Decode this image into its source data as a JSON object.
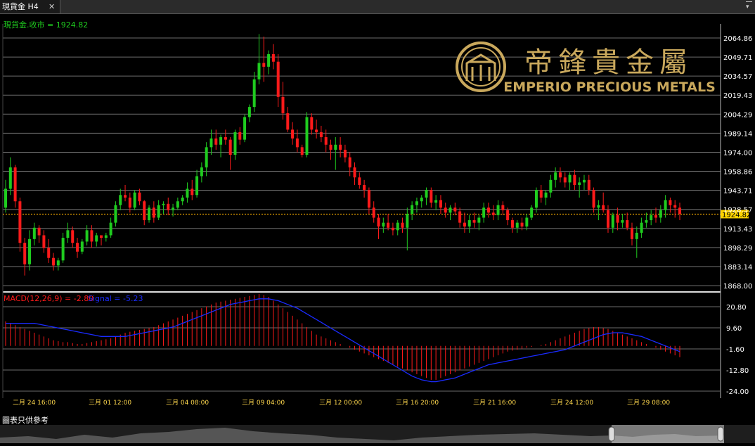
{
  "window": {
    "tab_title": "現貨金 H4",
    "close_glyph": "✕",
    "menu_glyph": "▾"
  },
  "price_panel": {
    "label": "現貨金.收市 = 1924.82",
    "current_price": 1924.82,
    "current_price_label": "1924.82",
    "y_axis_ticks": [
      "2064.86",
      "2049.71",
      "2034.57",
      "2019.43",
      "2004.29",
      "1989.14",
      "1974.00",
      "1958.86",
      "1943.71",
      "1928.57",
      "1913.43",
      "1898.29",
      "1883.14",
      "1868.00"
    ],
    "y_axis_values": [
      2064.86,
      2049.71,
      2034.57,
      2019.43,
      2004.29,
      1989.14,
      1974.0,
      1958.86,
      1943.71,
      1928.57,
      1913.43,
      1898.29,
      1883.14,
      1868.0
    ]
  },
  "watermark": {
    "name_chinese": "帝鋒貴金屬",
    "name_english": "EMPERIO PRECIOUS METALS"
  },
  "macd_panel": {
    "macd_label": "MACD(12,26,9) = -2.80",
    "signal_label": "Signal = -5.23",
    "y_axis_ticks": [
      "20.80",
      "9.60",
      "-1.60",
      "-12.80",
      "-24.00"
    ],
    "y_axis_values": [
      20.8,
      9.6,
      -1.6,
      -12.8,
      -24.0
    ]
  },
  "time_axis": {
    "labels": [
      "二月 24 16:00",
      "三月 01 12:00",
      "三月 04 08:00",
      "三月 09 04:00",
      "三月 12 00:00",
      "三月 16 20:00",
      "三月 21 16:00",
      "三月 24 12:00",
      "三月 29 08:00"
    ]
  },
  "footer": {
    "disclaimer": "圖表只供參考"
  },
  "colors": {
    "up": "#1fcc1f",
    "down": "#ff1a1a",
    "signal_line": "#1a2bff",
    "grid": "#6b6b6b",
    "axis_text": "#ffffff",
    "price_line": "#ffb300",
    "gold": "#c9a85c"
  },
  "chart_data": {
    "type": "candlestick",
    "timeframe": "H4",
    "symbol": "現貨金",
    "ohlc": [
      [
        1930,
        1952,
        1926,
        1945
      ],
      [
        1945,
        1970,
        1940,
        1962
      ],
      [
        1962,
        1964,
        1930,
        1935
      ],
      [
        1935,
        1938,
        1895,
        1902
      ],
      [
        1902,
        1906,
        1876,
        1885
      ],
      [
        1885,
        1912,
        1880,
        1905
      ],
      [
        1905,
        1918,
        1900,
        1914
      ],
      [
        1914,
        1916,
        1902,
        1908
      ],
      [
        1908,
        1912,
        1894,
        1898
      ],
      [
        1898,
        1905,
        1886,
        1890
      ],
      [
        1890,
        1894,
        1880,
        1884
      ],
      [
        1884,
        1890,
        1880,
        1888
      ],
      [
        1888,
        1910,
        1886,
        1906
      ],
      [
        1906,
        1918,
        1902,
        1912
      ],
      [
        1912,
        1915,
        1898,
        1902
      ],
      [
        1902,
        1906,
        1890,
        1895
      ],
      [
        1895,
        1905,
        1893,
        1903
      ],
      [
        1903,
        1916,
        1900,
        1912
      ],
      [
        1912,
        1916,
        1898,
        1903
      ],
      [
        1903,
        1910,
        1899,
        1908
      ],
      [
        1908,
        1908,
        1900,
        1906
      ],
      [
        1906,
        1910,
        1903,
        1908
      ],
      [
        1908,
        1922,
        1906,
        1918
      ],
      [
        1918,
        1935,
        1915,
        1932
      ],
      [
        1932,
        1945,
        1928,
        1940
      ],
      [
        1940,
        1948,
        1935,
        1938
      ],
      [
        1938,
        1942,
        1926,
        1930
      ],
      [
        1930,
        1944,
        1928,
        1942
      ],
      [
        1942,
        1945,
        1932,
        1935
      ],
      [
        1935,
        1936,
        1916,
        1920
      ],
      [
        1920,
        1932,
        1918,
        1930
      ],
      [
        1930,
        1935,
        1918,
        1922
      ],
      [
        1922,
        1936,
        1920,
        1932
      ],
      [
        1932,
        1935,
        1925,
        1933
      ],
      [
        1933,
        1938,
        1924,
        1928
      ],
      [
        1928,
        1933,
        1923,
        1930
      ],
      [
        1930,
        1938,
        1928,
        1935
      ],
      [
        1935,
        1940,
        1932,
        1938
      ],
      [
        1938,
        1950,
        1934,
        1945
      ],
      [
        1945,
        1952,
        1936,
        1940
      ],
      [
        1940,
        1960,
        1938,
        1955
      ],
      [
        1955,
        1966,
        1950,
        1962
      ],
      [
        1962,
        1982,
        1955,
        1978
      ],
      [
        1978,
        1992,
        1972,
        1985
      ],
      [
        1985,
        1992,
        1976,
        1980
      ],
      [
        1980,
        1988,
        1970,
        1986
      ],
      [
        1986,
        1992,
        1980,
        1984
      ],
      [
        1984,
        1986,
        1960,
        1972
      ],
      [
        1972,
        1992,
        1968,
        1990
      ],
      [
        1990,
        1994,
        1980,
        1984
      ],
      [
        1984,
        2004,
        1982,
        2002
      ],
      [
        2002,
        2012,
        1998,
        2010
      ],
      [
        2010,
        2038,
        2006,
        2032
      ],
      [
        2032,
        2068,
        2028,
        2045
      ],
      [
        2045,
        2066,
        2030,
        2042
      ],
      [
        2042,
        2055,
        2036,
        2052
      ],
      [
        2052,
        2060,
        2040,
        2046
      ],
      [
        2046,
        2052,
        2010,
        2018
      ],
      [
        2018,
        2030,
        2000,
        2005
      ],
      [
        2005,
        2010,
        1990,
        1992
      ],
      [
        1992,
        1998,
        1980,
        1985
      ],
      [
        1985,
        1992,
        1974,
        1978
      ],
      [
        1978,
        1980,
        1970,
        1972
      ],
      [
        1972,
        2006,
        1970,
        2002
      ],
      [
        2002,
        2005,
        1988,
        1992
      ],
      [
        1992,
        2000,
        1985,
        1990
      ],
      [
        1990,
        1995,
        1982,
        1986
      ],
      [
        1986,
        1992,
        1974,
        1980
      ],
      [
        1980,
        1984,
        1968,
        1976
      ],
      [
        1976,
        1986,
        1960,
        1980
      ],
      [
        1980,
        1986,
        1970,
        1976
      ],
      [
        1976,
        1980,
        1966,
        1970
      ],
      [
        1970,
        1974,
        1955,
        1962
      ],
      [
        1962,
        1966,
        1948,
        1954
      ],
      [
        1954,
        1958,
        1945,
        1948
      ],
      [
        1948,
        1952,
        1938,
        1944
      ],
      [
        1944,
        1946,
        1925,
        1930
      ],
      [
        1930,
        1935,
        1918,
        1922
      ],
      [
        1922,
        1925,
        1905,
        1915
      ],
      [
        1915,
        1922,
        1910,
        1918
      ],
      [
        1918,
        1925,
        1912,
        1914
      ],
      [
        1914,
        1918,
        1908,
        1912
      ],
      [
        1912,
        1920,
        1908,
        1918
      ],
      [
        1918,
        1922,
        1910,
        1914
      ],
      [
        1914,
        1930,
        1896,
        1925
      ],
      [
        1925,
        1935,
        1920,
        1932
      ],
      [
        1932,
        1938,
        1926,
        1935
      ],
      [
        1935,
        1940,
        1930,
        1938
      ],
      [
        1938,
        1946,
        1932,
        1944
      ],
      [
        1944,
        1946,
        1930,
        1934
      ],
      [
        1934,
        1940,
        1928,
        1936
      ],
      [
        1936,
        1940,
        1925,
        1930
      ],
      [
        1930,
        1934,
        1922,
        1926
      ],
      [
        1926,
        1932,
        1920,
        1930
      ],
      [
        1930,
        1934,
        1924,
        1927
      ],
      [
        1927,
        1930,
        1914,
        1918
      ],
      [
        1918,
        1926,
        1910,
        1915
      ],
      [
        1915,
        1924,
        1910,
        1920
      ],
      [
        1920,
        1926,
        1914,
        1918
      ],
      [
        1918,
        1924,
        1912,
        1922
      ],
      [
        1922,
        1934,
        1918,
        1930
      ],
      [
        1930,
        1934,
        1922,
        1926
      ],
      [
        1926,
        1932,
        1920,
        1924
      ],
      [
        1924,
        1936,
        1920,
        1932
      ],
      [
        1932,
        1935,
        1924,
        1928
      ],
      [
        1928,
        1930,
        1916,
        1920
      ],
      [
        1920,
        1922,
        1910,
        1914
      ],
      [
        1914,
        1920,
        1910,
        1918
      ],
      [
        1918,
        1922,
        1912,
        1915
      ],
      [
        1915,
        1925,
        1912,
        1922
      ],
      [
        1922,
        1932,
        1920,
        1930
      ],
      [
        1930,
        1946,
        1926,
        1944
      ],
      [
        1944,
        1948,
        1934,
        1938
      ],
      [
        1938,
        1944,
        1932,
        1942
      ],
      [
        1942,
        1956,
        1938,
        1952
      ],
      [
        1952,
        1962,
        1946,
        1958
      ],
      [
        1958,
        1962,
        1950,
        1954
      ],
      [
        1954,
        1958,
        1946,
        1950
      ],
      [
        1950,
        1958,
        1944,
        1956
      ],
      [
        1956,
        1960,
        1944,
        1948
      ],
      [
        1948,
        1954,
        1938,
        1950
      ],
      [
        1950,
        1956,
        1944,
        1952
      ],
      [
        1952,
        1956,
        1940,
        1944
      ],
      [
        1944,
        1946,
        1926,
        1930
      ],
      [
        1930,
        1936,
        1920,
        1932
      ],
      [
        1932,
        1942,
        1926,
        1928
      ],
      [
        1928,
        1932,
        1910,
        1914
      ],
      [
        1914,
        1926,
        1910,
        1924
      ],
      [
        1924,
        1930,
        1912,
        1918
      ],
      [
        1918,
        1925,
        1914,
        1920
      ],
      [
        1920,
        1926,
        1912,
        1914
      ],
      [
        1914,
        1918,
        1900,
        1905
      ],
      [
        1905,
        1915,
        1890,
        1910
      ],
      [
        1910,
        1922,
        1906,
        1918
      ],
      [
        1918,
        1926,
        1914,
        1920
      ],
      [
        1920,
        1928,
        1916,
        1924
      ],
      [
        1924,
        1930,
        1918,
        1922
      ],
      [
        1922,
        1932,
        1918,
        1928
      ],
      [
        1928,
        1940,
        1922,
        1936
      ],
      [
        1936,
        1938,
        1926,
        1932
      ],
      [
        1932,
        1936,
        1922,
        1930
      ],
      [
        1930,
        1934,
        1920,
        1925
      ]
    ],
    "macd_histogram": [
      13,
      12,
      11,
      10,
      9,
      8,
      7,
      6,
      5,
      4,
      3,
      2.5,
      2,
      2,
      1.5,
      1,
      1,
      1.5,
      2,
      2.5,
      3,
      3.5,
      4,
      5,
      6,
      7,
      7.5,
      8,
      8.5,
      9,
      9.5,
      10,
      11,
      12,
      13,
      14,
      15,
      16,
      17,
      18,
      19,
      20,
      21,
      22,
      23,
      23.5,
      24,
      24.5,
      25,
      25.5,
      26,
      26.5,
      27,
      27.5,
      27,
      26,
      24,
      22,
      20,
      18,
      16,
      14,
      12,
      10,
      8,
      6,
      5,
      4,
      3,
      2,
      1,
      0,
      -1,
      -2,
      -3,
      -4,
      -5,
      -6,
      -7,
      -8,
      -9,
      -10,
      -11,
      -12,
      -13,
      -14,
      -15,
      -16,
      -17,
      -18,
      -18,
      -17,
      -16,
      -15,
      -14,
      -13,
      -12,
      -11,
      -10,
      -9,
      -8,
      -7,
      -6,
      -5,
      -4,
      -3,
      -2.5,
      -2,
      -1.5,
      -1,
      -0.5,
      0,
      0.5,
      1,
      2,
      3,
      4,
      5,
      6,
      7,
      8,
      9,
      9.5,
      10,
      10,
      9.5,
      9,
      8,
      7,
      6,
      5,
      4,
      3,
      2,
      1,
      0,
      -1,
      -2,
      -3,
      -4,
      -5,
      -6,
      -5,
      -4,
      -3
    ],
    "signal_line": [
      12,
      12,
      12,
      12,
      12,
      12,
      12,
      11.5,
      11,
      10.5,
      10,
      9.5,
      9,
      8.5,
      8,
      7.5,
      7,
      6.5,
      6,
      5.5,
      5,
      5,
      5,
      5,
      5,
      5,
      5.5,
      6,
      6.5,
      7,
      7.5,
      8,
      8.5,
      9,
      9.5,
      10,
      11,
      12,
      13,
      14,
      15,
      16,
      17,
      18,
      19,
      20,
      21,
      22,
      22.5,
      23,
      23.5,
      24,
      24.5,
      25,
      25,
      25,
      24.5,
      24,
      23,
      22,
      21,
      20,
      18.5,
      17,
      15.5,
      14,
      12.5,
      11,
      9.5,
      8,
      6.5,
      5,
      3.5,
      2,
      0.5,
      -1,
      -2.5,
      -4,
      -5.5,
      -7,
      -8.5,
      -10,
      -11.5,
      -13,
      -14.5,
      -16,
      -17,
      -18,
      -18.5,
      -19,
      -19,
      -18.5,
      -18,
      -17.5,
      -17,
      -16,
      -15,
      -14,
      -13,
      -12,
      -11,
      -10,
      -9.5,
      -9,
      -8.5,
      -8,
      -7.5,
      -7,
      -6.5,
      -6,
      -5.5,
      -5,
      -4.5,
      -4,
      -3.5,
      -3,
      -2.5,
      -2,
      -1,
      0,
      1,
      2,
      3,
      4,
      5,
      6,
      6.5,
      7,
      7,
      7,
      6.5,
      6,
      5.5,
      5,
      4,
      3,
      2,
      1,
      0,
      -1,
      -2,
      -3,
      -4,
      -5,
      -5.23
    ],
    "macd_value": -2.8,
    "signal_value": -5.23
  }
}
